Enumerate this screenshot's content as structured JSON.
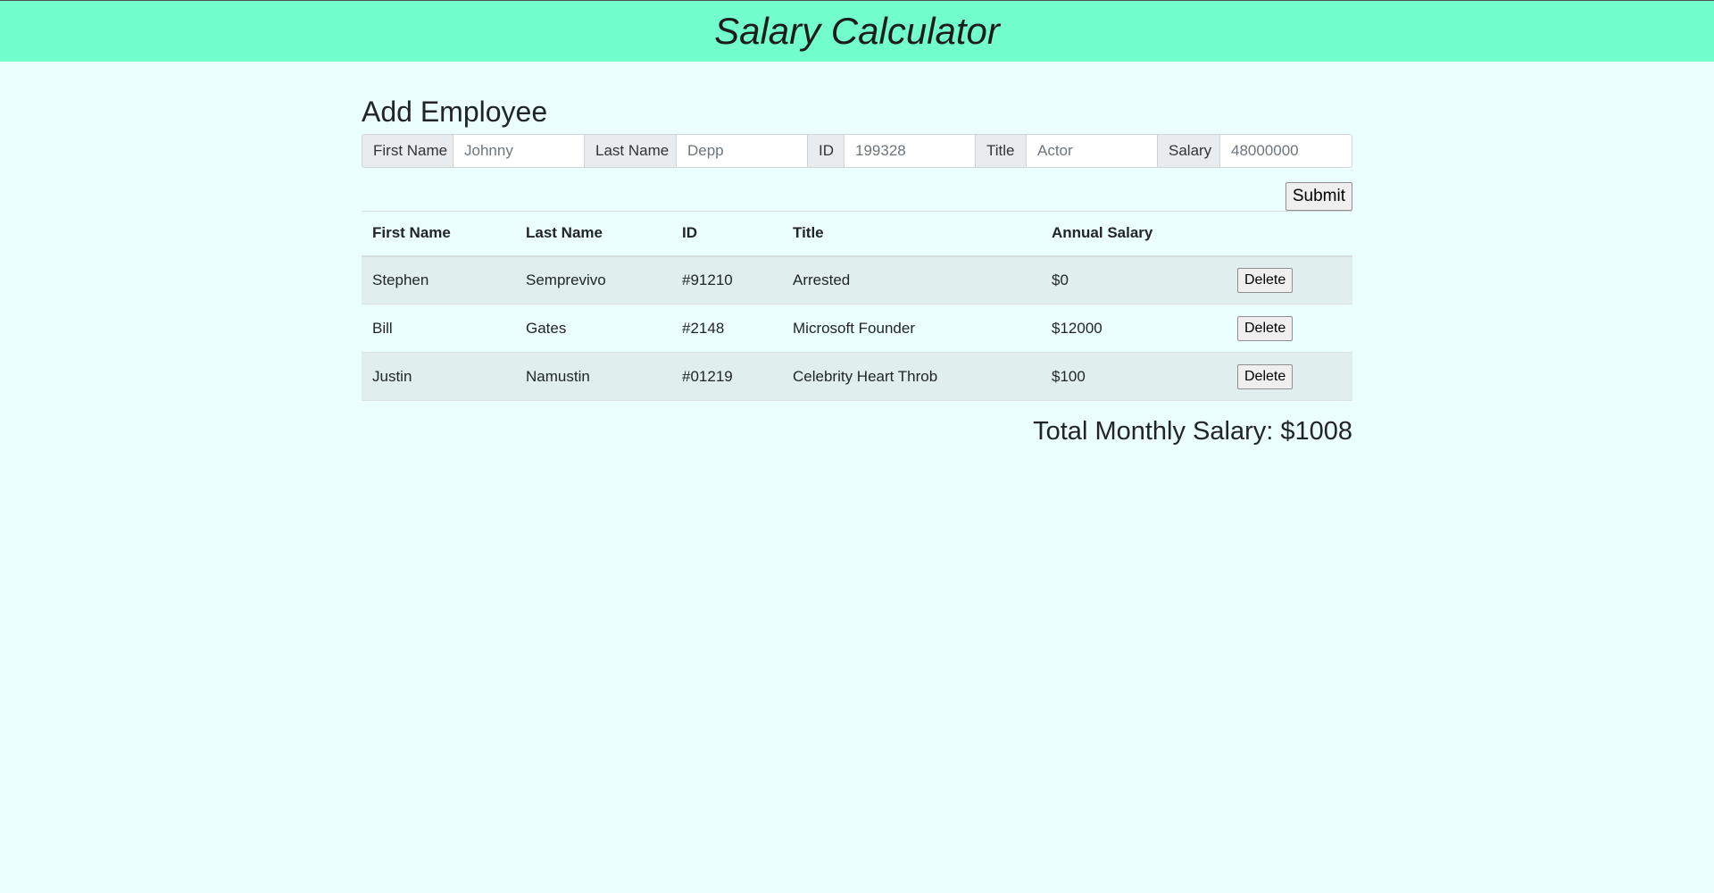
{
  "header": {
    "title": "Salary Calculator"
  },
  "form": {
    "heading": "Add Employee",
    "fields": [
      {
        "label": "First Name",
        "value": "Johnny"
      },
      {
        "label": "Last Name",
        "value": "Depp"
      },
      {
        "label": "ID",
        "value": "199328"
      },
      {
        "label": "Title",
        "value": "Actor"
      },
      {
        "label": "Salary",
        "value": "48000000"
      }
    ],
    "submit_label": "Submit"
  },
  "table": {
    "columns": [
      "First Name",
      "Last Name",
      "ID",
      "Title",
      "Annual Salary"
    ],
    "rows": [
      {
        "first": "Stephen",
        "last": "Semprevivo",
        "id": "#91210",
        "title": "Arrested",
        "salary": "$0",
        "action": "Delete"
      },
      {
        "first": "Bill",
        "last": "Gates",
        "id": "#2148",
        "title": "Microsoft Founder",
        "salary": "$12000",
        "action": "Delete"
      },
      {
        "first": "Justin",
        "last": "Namustin",
        "id": "#01219",
        "title": "Celebrity Heart Throb",
        "salary": "$100",
        "action": "Delete"
      }
    ]
  },
  "total": {
    "text": "Total Monthly Salary: $1008"
  },
  "colors": {
    "header_bg": "#73ffcb",
    "page_bg": "#ebfffe",
    "stripe": "#e0efee"
  }
}
